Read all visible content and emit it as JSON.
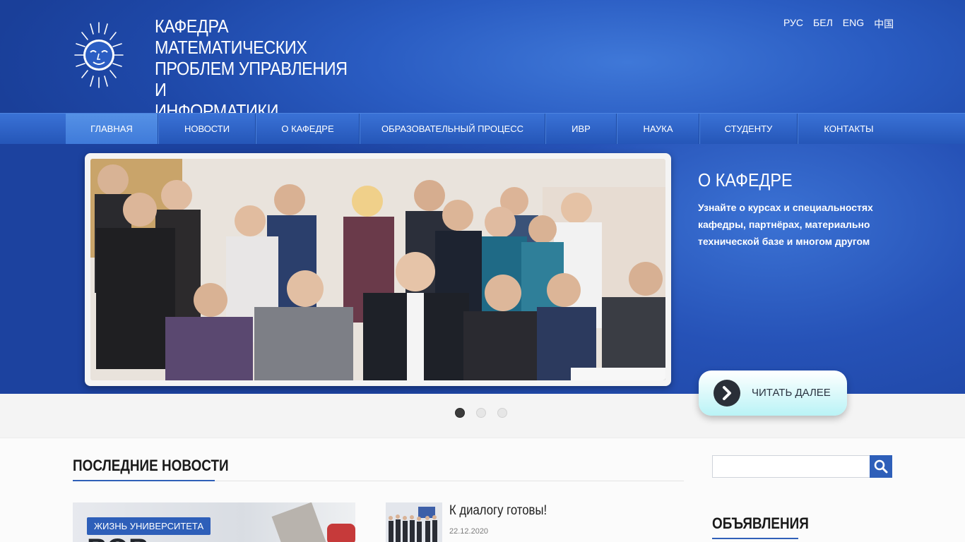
{
  "header": {
    "title_lines": [
      "КАФЕДРА",
      "МАТЕМАТИЧЕСКИХ",
      "ПРОБЛЕМ УПРАВЛЕНИЯ И",
      "ИНФОРМАТИКИ"
    ],
    "languages": [
      "РУС",
      "БЕЛ",
      "ENG",
      "中国"
    ],
    "logo_icon": "sun-face-logo"
  },
  "nav": {
    "items": [
      "ГЛАВНАЯ",
      "НОВОСТИ",
      "О КАФЕДРЕ",
      "ОБРАЗОВАТЕЛЬНЫЙ ПРОЦЕСС",
      "ИВР",
      "НАУКА",
      "СТУДЕНТУ",
      "КОНТАКТЫ"
    ],
    "active_index": 0
  },
  "hero": {
    "title": "О КАФЕДРЕ",
    "text": "Узнайте о курсах и специальностях кафедры, партнёрах, материально технической базе и многом другом",
    "read_more": "ЧИТАТЬ ДАЛЕЕ",
    "slides_total": 3,
    "active_slide": 0
  },
  "news": {
    "section_title": "ПОСЛЕДНИЕ НОВОСТИ",
    "featured_tag": "ЖИЗНЬ УНИВЕРСИТЕТА",
    "featured_text": "ВОВ",
    "items": [
      {
        "title": "К диалогу готовы!",
        "date": "22.12.2020"
      }
    ]
  },
  "sidebar": {
    "search_placeholder": "",
    "ads_title": "ОБЪЯВЛЕНИЯ"
  },
  "colors": {
    "primary": "#2e5fb9",
    "header_bg": "#2a5cc2",
    "nav_active": "#4a86e0"
  }
}
